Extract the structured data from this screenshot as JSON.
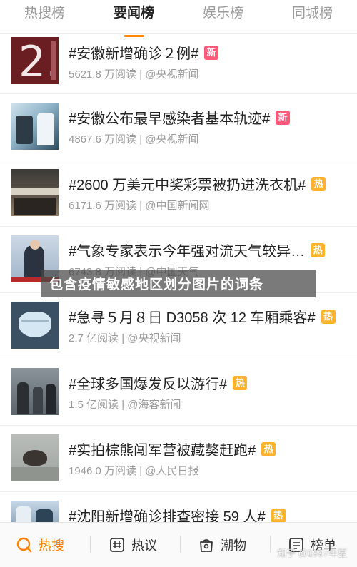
{
  "tabs": [
    {
      "label": "热搜榜",
      "active": false
    },
    {
      "label": "要闻榜",
      "active": true
    },
    {
      "label": "娱乐榜",
      "active": false
    },
    {
      "label": "同城榜",
      "active": false
    }
  ],
  "items": [
    {
      "title": "#安徽新增确诊２例#",
      "reads": "5621.8 万阅读",
      "source": "| @央视新闻",
      "badge": "新",
      "badge_type": "new",
      "thumb_text": "2."
    },
    {
      "title": "#安徽公布最早感染者基本轨迹#",
      "reads": "4867.6 万阅读",
      "source": "| @央视新闻",
      "badge": "新",
      "badge_type": "new"
    },
    {
      "title": "#2600 万美元中奖彩票被扔进洗衣机#",
      "reads": "6171.6 万阅读",
      "source": "| @中国新闻网",
      "badge": "热",
      "badge_type": "hot"
    },
    {
      "title": "#气象专家表示今年强对流天气较异…",
      "reads": "6743.8 万阅读",
      "source": "| @中国天气",
      "badge": "热",
      "badge_type": "hot"
    },
    {
      "title": "#急寻５月８日 D3058 次 12 车厢乘客#",
      "reads": "2.7 亿阅读",
      "source": "| @央视新闻",
      "badge": "热",
      "badge_type": "hot"
    },
    {
      "title": "#全球多国爆发反以游行#",
      "reads": "1.5 亿阅读",
      "source": "| @海客新闻",
      "badge": "热",
      "badge_type": "hot"
    },
    {
      "title": "#实拍棕熊闯军营被藏獒赶跑#",
      "reads": "1946.0 万阅读",
      "source": "| @人民日报",
      "badge": "热",
      "badge_type": "hot"
    },
    {
      "title": "#沈阳新增确诊排查密接 59 人#",
      "reads": "",
      "source": "",
      "badge": "热",
      "badge_type": "hot"
    }
  ],
  "banner": {
    "text": "包含疫情敏感地区划分图片的词条"
  },
  "bottom_nav": [
    {
      "label": "热搜",
      "icon": "search-icon",
      "active": true
    },
    {
      "label": "热议",
      "icon": "hashtag-icon",
      "active": false
    },
    {
      "label": "潮物",
      "icon": "bag-icon",
      "active": false
    },
    {
      "label": "榜单",
      "icon": "list-icon",
      "active": false
    }
  ],
  "watermark": "知乎 @1997年夏",
  "colors": {
    "accent": "#ff8200",
    "badge_new": "#ff5a7a",
    "badge_hot": "#ffb22c"
  }
}
